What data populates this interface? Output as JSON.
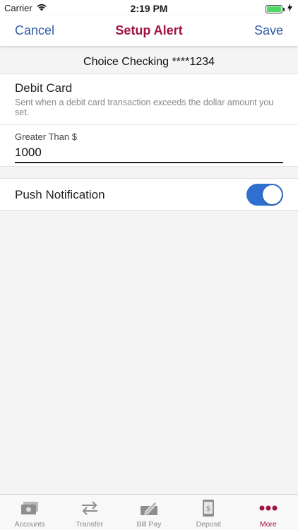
{
  "status_bar": {
    "carrier": "Carrier",
    "time": "2:19 PM",
    "battery_level": 1.0
  },
  "nav": {
    "cancel_label": "Cancel",
    "title": "Setup Alert",
    "save_label": "Save"
  },
  "account": {
    "name": "Choice Checking ****1234"
  },
  "alert": {
    "title": "Debit Card",
    "description": "Sent when a debit card transaction exceeds the dollar amount you set.",
    "amount_label": "Greater Than $",
    "amount_value": "1000"
  },
  "push": {
    "label": "Push Notification",
    "enabled": true
  },
  "tabs": [
    {
      "label": "Accounts",
      "icon": "cash-icon",
      "active": false
    },
    {
      "label": "Transfer",
      "icon": "transfer-arrows-icon",
      "active": false
    },
    {
      "label": "Bill Pay",
      "icon": "check-pen-icon",
      "active": false
    },
    {
      "label": "Deposit",
      "icon": "phone-dollar-icon",
      "active": false
    },
    {
      "label": "More",
      "icon": "more-dots-icon",
      "active": true
    }
  ],
  "colors": {
    "brand": "#a11242",
    "link": "#2f5aa8",
    "toggle_on": "#2f6fd0",
    "background": "#f5f4f5"
  }
}
